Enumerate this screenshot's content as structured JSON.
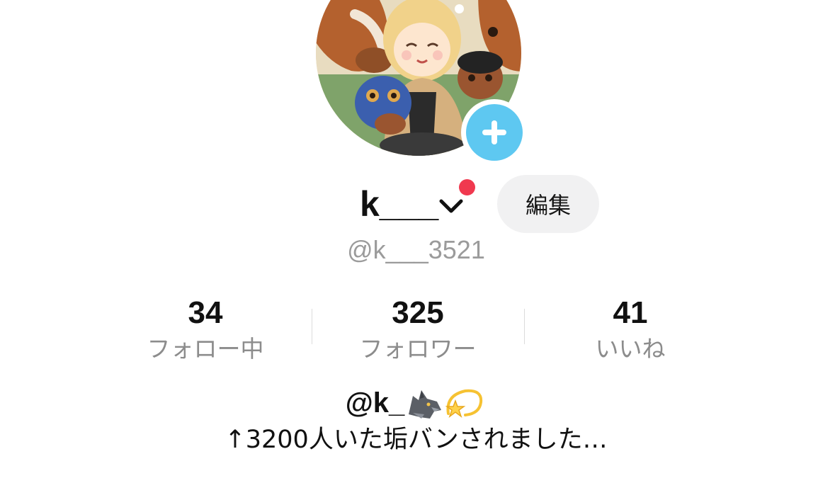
{
  "profile": {
    "display_name": "k___",
    "username": "@k___3521",
    "edit_label": "編集"
  },
  "stats": [
    {
      "value": "34",
      "label": "フォロー中"
    },
    {
      "value": "325",
      "label": "フォロワー"
    },
    {
      "value": "41",
      "label": "いいね"
    }
  ],
  "bio": {
    "handle": "@k_",
    "handle_emojis": [
      "wolf-emoji-icon",
      "dizzy-star-emoji-icon"
    ],
    "text": "↑3200人いた垢バンされました…"
  },
  "colors": {
    "add_button": "#5ec8f1",
    "notification_dot": "#f0394f",
    "edit_button_bg": "#f1f1f2",
    "secondary_text": "#8c8c8c"
  }
}
